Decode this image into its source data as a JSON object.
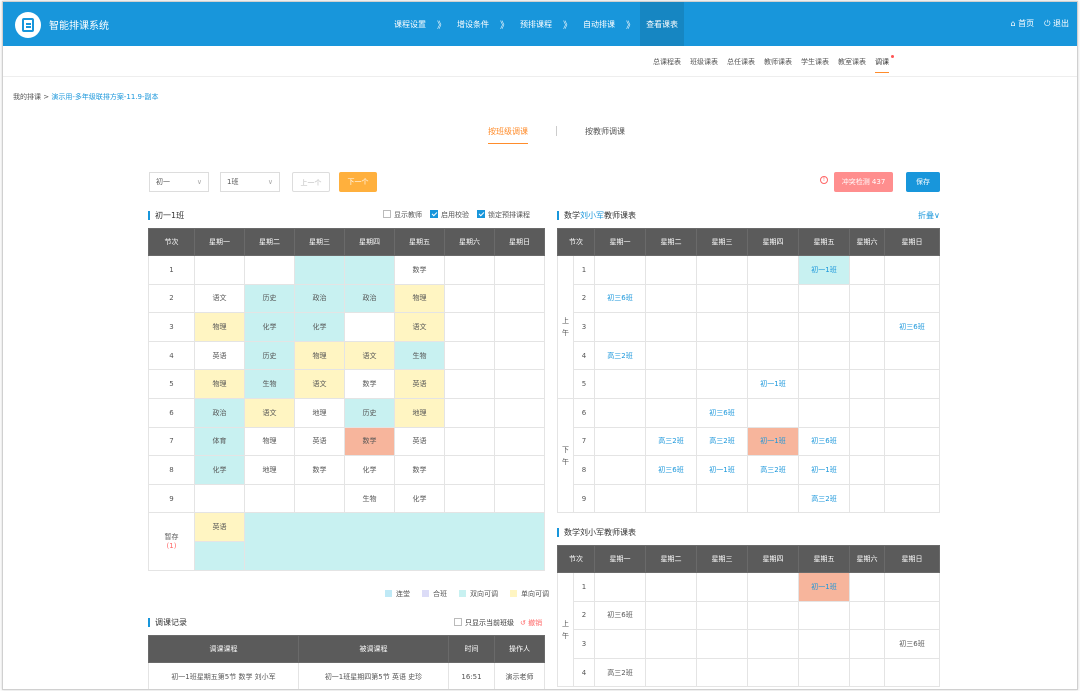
{
  "header": {
    "app_title": "智能排课系统",
    "steps": [
      "课程设置",
      "增设条件",
      "预排课程",
      "自动排课",
      "查看课表"
    ],
    "arrow": "》",
    "home": "首页",
    "logout": "退出"
  },
  "subnav": {
    "items": [
      "总课程表",
      "班级课表",
      "总任课表",
      "教师课表",
      "学生课表",
      "教室课表",
      "调课"
    ]
  },
  "breadcrumb": {
    "root": "我的排课",
    "sep": ">",
    "current": "演示用-多年级联排方案-11.9-副本"
  },
  "modes": {
    "by_class": "按班级调课",
    "by_teacher": "按教师调课"
  },
  "toolbar": {
    "grade": "初一",
    "klass": "1班",
    "prev": "上一个",
    "next": "下一个",
    "conflict": "冲突检测 437",
    "save": "保存",
    "chevron": "∨"
  },
  "left": {
    "title": "初一1班",
    "opt_show_teacher": "显示教师",
    "opt_check": "启用校验",
    "opt_lock": "锁定预排课程",
    "headers": [
      "节次",
      "星期一",
      "星期二",
      "星期三",
      "星期四",
      "星期五",
      "星期六",
      "星期日"
    ],
    "rows": [
      {
        "n": "1",
        "cells": [
          "",
          "",
          "",
          "",
          "数学",
          "",
          ""
        ]
      },
      {
        "n": "2",
        "cells": [
          "语文",
          "历史",
          "政治",
          "政治",
          "物理",
          "",
          ""
        ]
      },
      {
        "n": "3",
        "cells": [
          "物理",
          "化学",
          "化学",
          "",
          "语文",
          "",
          ""
        ]
      },
      {
        "n": "4",
        "cells": [
          "英语",
          "历史",
          "物理",
          "语文",
          "生物",
          "",
          ""
        ]
      },
      {
        "n": "5",
        "cells": [
          "物理",
          "生物",
          "语文",
          "数学",
          "英语",
          "",
          ""
        ]
      },
      {
        "n": "6",
        "cells": [
          "政治",
          "语文",
          "地理",
          "历史",
          "地理",
          "",
          ""
        ]
      },
      {
        "n": "7",
        "cells": [
          "体育",
          "物理",
          "英语",
          "数学",
          "英语",
          "",
          ""
        ]
      },
      {
        "n": "8",
        "cells": [
          "化学",
          "地理",
          "数学",
          "化学",
          "数学",
          "",
          ""
        ]
      },
      {
        "n": "9",
        "cells": [
          "",
          "",
          "",
          "生物",
          "化学",
          "",
          ""
        ]
      }
    ],
    "temp_label": "暂存",
    "temp_count": "(1)",
    "temp_item": "英语",
    "legend": [
      "连堂",
      "合班",
      "双向可调",
      "单向可调"
    ]
  },
  "record": {
    "title": "调课记录",
    "only_current": "只显示当前班级",
    "revoke": "撤销",
    "headers": [
      "调课课程",
      "被调课程",
      "时间",
      "操作人"
    ],
    "rows": [
      [
        "初一1班星期五第5节 数学 刘小军",
        "初一1班星期四第5节 英语 史珍",
        "16:51",
        "演示老师"
      ]
    ]
  },
  "teacher1": {
    "title_pre": "数学",
    "title_name": "刘小军",
    "title_post": "教师课表",
    "fold": "折叠∨",
    "headers": [
      "节次",
      "",
      "星期一",
      "星期二",
      "星期三",
      "星期四",
      "星期五",
      "星期六",
      "星期日"
    ],
    "am": "上午",
    "pm": "下午",
    "rows": [
      {
        "n": "1",
        "cells": [
          "",
          "",
          "",
          "",
          "初一1班",
          "",
          ""
        ]
      },
      {
        "n": "2",
        "cells": [
          "初三6班",
          "",
          "",
          "",
          "",
          "",
          ""
        ]
      },
      {
        "n": "3",
        "cells": [
          "",
          "",
          "",
          "",
          "",
          "",
          "初三6班"
        ]
      },
      {
        "n": "4",
        "cells": [
          "高三2班",
          "",
          "",
          "",
          "",
          "",
          ""
        ]
      },
      {
        "n": "5",
        "cells": [
          "",
          "",
          "",
          "初一1班",
          "",
          "",
          ""
        ]
      },
      {
        "n": "6",
        "cells": [
          "",
          "",
          "初三6班",
          "",
          "",
          "",
          ""
        ]
      },
      {
        "n": "7",
        "cells": [
          "",
          "高三2班",
          "高三2班",
          "初一1班",
          "初三6班",
          "",
          ""
        ]
      },
      {
        "n": "8",
        "cells": [
          "",
          "初三6班",
          "初一1班",
          "高三2班",
          "初一1班",
          "",
          ""
        ]
      },
      {
        "n": "9",
        "cells": [
          "",
          "",
          "",
          "",
          "高三2班",
          "",
          ""
        ]
      }
    ]
  },
  "teacher2": {
    "title_pre": "数学",
    "title_name": "刘小军",
    "title_post": "教师课表",
    "am": "上午",
    "rows": [
      {
        "n": "1",
        "cells": [
          "",
          "",
          "",
          "",
          "初一1班",
          "",
          ""
        ]
      },
      {
        "n": "2",
        "cells": [
          "初三6班",
          "",
          "",
          "",
          "",
          "",
          ""
        ]
      },
      {
        "n": "3",
        "cells": [
          "",
          "",
          "",
          "",
          "",
          "",
          "初三6班"
        ]
      },
      {
        "n": "4",
        "cells": [
          "高三2班",
          "",
          "",
          "",
          "",
          "",
          ""
        ]
      }
    ]
  },
  "colors": {
    "primary": "#1896db",
    "accent": "#ff8c2b",
    "cyan": "#c8f1f1",
    "yellow": "#fff5c2",
    "red": "#f7b59c",
    "lilac": "#dcdcf7"
  }
}
